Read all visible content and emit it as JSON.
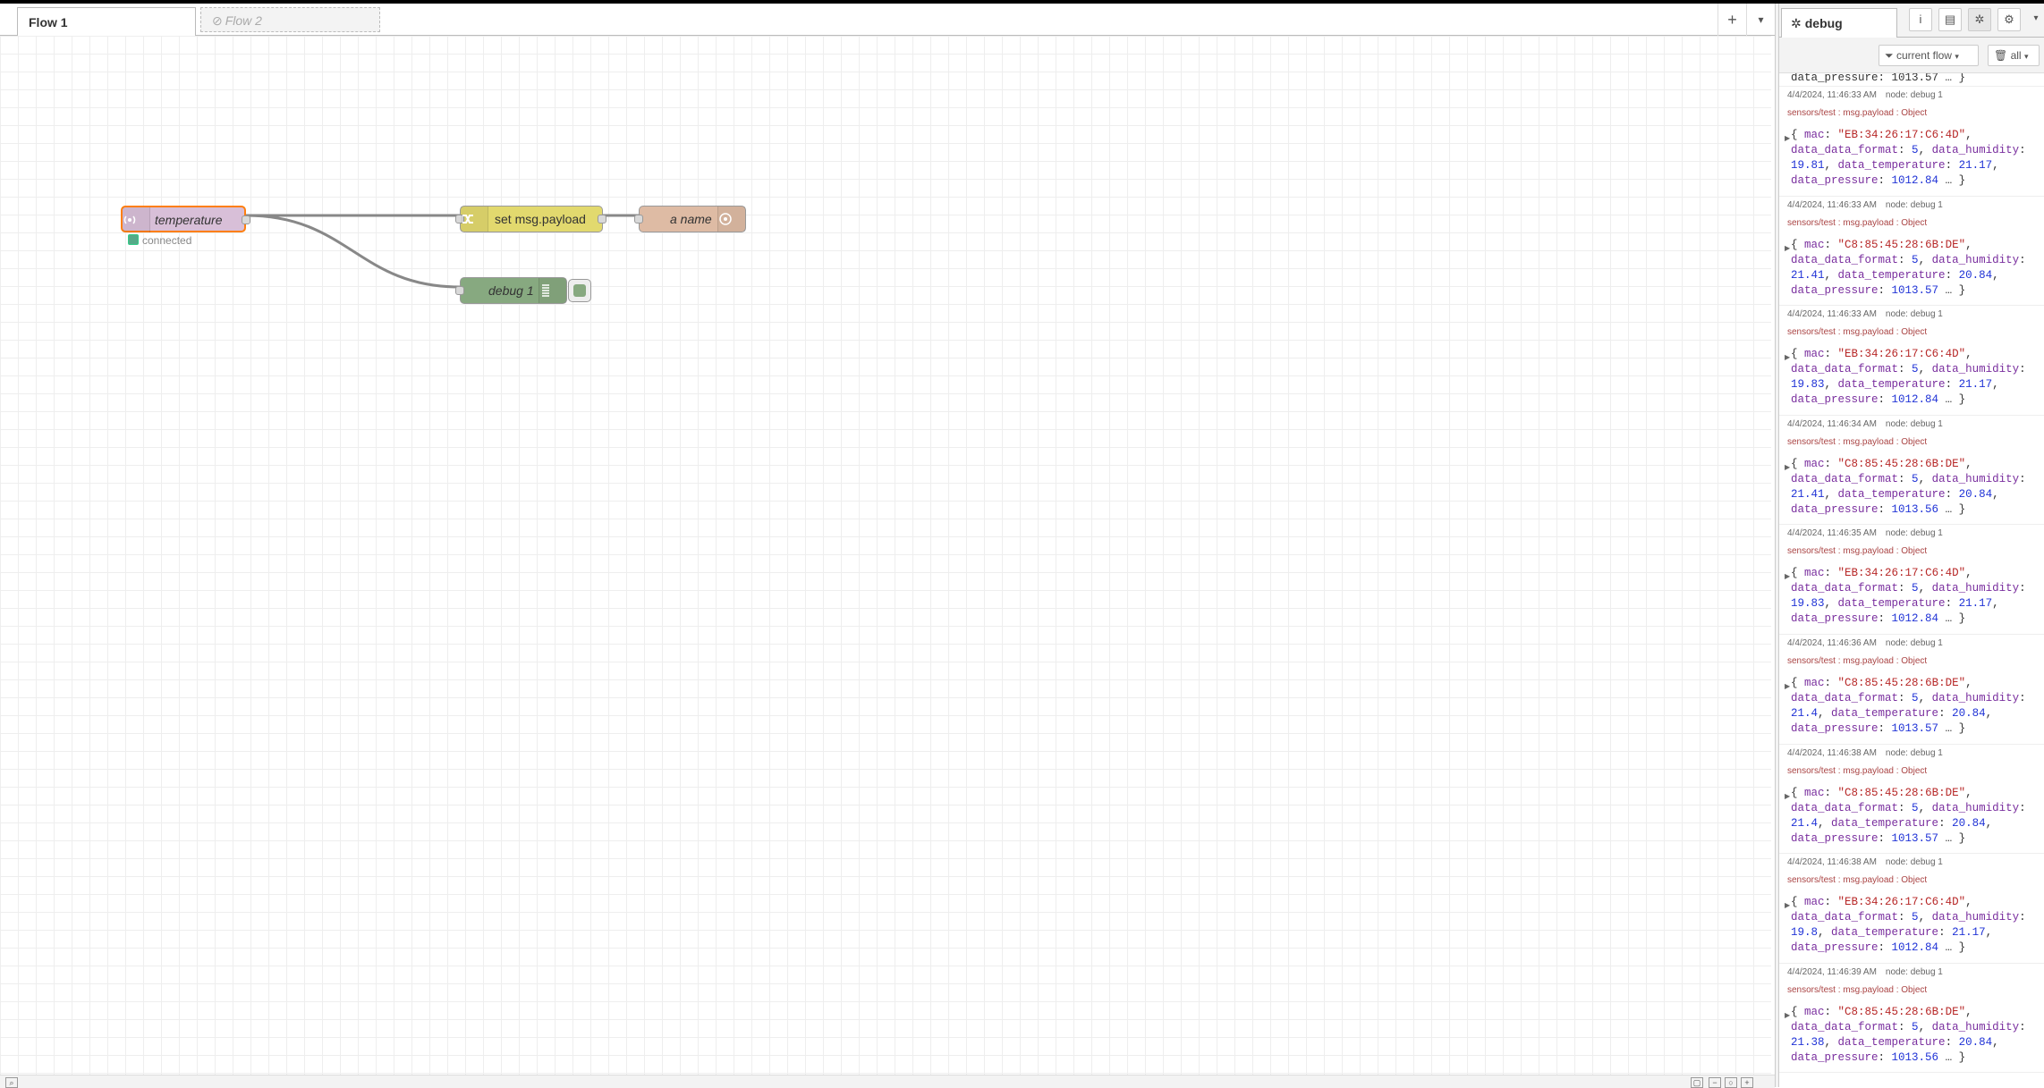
{
  "workspace": {
    "tabs": [
      {
        "label": "Flow 1",
        "active": true
      },
      {
        "label": "Flow 2",
        "disabled": true
      }
    ],
    "actions": {
      "add": "+",
      "menu": "▾"
    }
  },
  "flow": {
    "nodes": {
      "temperature": {
        "label": "temperature",
        "status": "connected"
      },
      "change": {
        "label": "set msg.payload"
      },
      "named": {
        "label": "a name"
      },
      "debug": {
        "label": "debug 1"
      }
    }
  },
  "sidebar": {
    "active_tab": "debug",
    "filter_label": "current flow",
    "clear_label": "all",
    "messages": [
      {
        "time": "4/4/2024, 11:46:33 AM",
        "node": "node: debug 1",
        "topic": "sensors/test : msg.payload : Object",
        "mac": "\"EB:34:26:17:C6:4D\"",
        "format": "5",
        "humidity": "19.81",
        "temperature": "21.17",
        "pressure": "1012.84",
        "wrap": "humidity"
      },
      {
        "time": "4/4/2024, 11:46:33 AM",
        "node": "node: debug 1",
        "topic": "sensors/test : msg.payload : Object",
        "mac": "\"C8:85:45:28:6B:DE\"",
        "format": "5",
        "humidity": "21.41",
        "temperature": "20.84",
        "pressure": "1013.57",
        "wrap": "humidity"
      },
      {
        "time": "4/4/2024, 11:46:33 AM",
        "node": "node: debug 1",
        "topic": "sensors/test : msg.payload : Object",
        "mac": "\"EB:34:26:17:C6:4D\"",
        "format": "5",
        "humidity": "19.83",
        "temperature": "21.17",
        "pressure": "1012.84",
        "wrap": "humidity"
      },
      {
        "time": "4/4/2024, 11:46:34 AM",
        "node": "node: debug 1",
        "topic": "sensors/test : msg.payload : Object",
        "mac": "\"C8:85:45:28:6B:DE\"",
        "format": "5",
        "humidity": "21.41",
        "temperature": "20.84",
        "pressure": "1013.56",
        "wrap": "humidity"
      },
      {
        "time": "4/4/2024, 11:46:35 AM",
        "node": "node: debug 1",
        "topic": "sensors/test : msg.payload : Object",
        "mac": "\"EB:34:26:17:C6:4D\"",
        "format": "5",
        "humidity": "19.83",
        "temperature": "21.17",
        "pressure": "1012.84",
        "wrap": "humidity"
      },
      {
        "time": "4/4/2024, 11:46:36 AM",
        "node": "node: debug 1",
        "topic": "sensors/test : msg.payload : Object",
        "mac": "\"C8:85:45:28:6B:DE\"",
        "format": "5",
        "humidity": "21.4",
        "temperature": "20.84",
        "pressure": "1013.57",
        "wrap": "humidity"
      },
      {
        "time": "4/4/2024, 11:46:38 AM",
        "node": "node: debug 1",
        "topic": "sensors/test : msg.payload : Object",
        "mac": "\"C8:85:45:28:6B:DE\"",
        "format": "5",
        "humidity": "21.4",
        "temperature": "20.84",
        "pressure": "1013.57",
        "wrap": "humidity"
      },
      {
        "time": "4/4/2024, 11:46:38 AM",
        "node": "node: debug 1",
        "topic": "sensors/test : msg.payload : Object",
        "mac": "\"EB:34:26:17:C6:4D\"",
        "format": "5",
        "humidity": "19.8",
        "temperature": "21.17",
        "pressure": "1012.84",
        "wrap": "humidity"
      },
      {
        "time": "4/4/2024, 11:46:39 AM",
        "node": "node: debug 1",
        "topic": "sensors/test : msg.payload : Object",
        "mac": "\"C8:85:45:28:6B:DE\"",
        "format": "5",
        "humidity": "21.38",
        "temperature": "20.84",
        "pressure": "1013.56",
        "wrap": "humidity"
      }
    ],
    "partial_top": "data_pressure: 1013.57 … }"
  },
  "colors": {
    "temperature_node": "#d8bfd8",
    "change_node": "#e2d96e",
    "named_node": "#debba4",
    "debug_node": "#87a980",
    "selected_border": "#ff7f0e"
  },
  "icons": {
    "temperature": "mqtt-icon",
    "change": "shuffle-icon",
    "named": "link-icon",
    "debug": "list-icon"
  }
}
